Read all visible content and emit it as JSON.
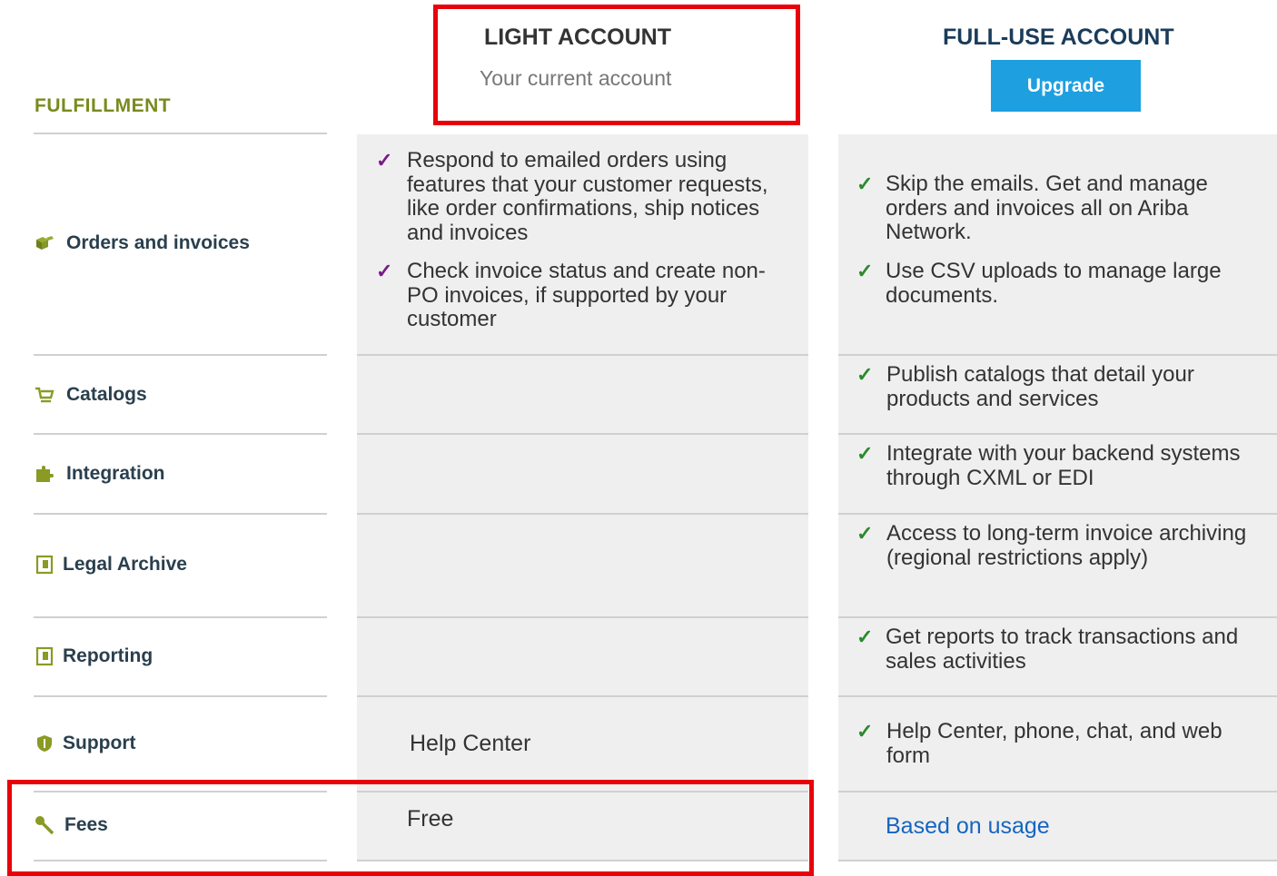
{
  "header": {
    "light_title": "LIGHT ACCOUNT",
    "light_subtitle": "Your current account",
    "full_title": "FULL-USE ACCOUNT",
    "upgrade_label": "Upgrade",
    "section_label": "FULFILLMENT"
  },
  "rows": [
    {
      "label": "Orders and invoices",
      "icon": "boxes-icon"
    },
    {
      "label": "Catalogs",
      "icon": "cart-icon"
    },
    {
      "label": "Integration",
      "icon": "puzzle-icon"
    },
    {
      "label": "Legal Archive",
      "icon": "document-icon"
    },
    {
      "label": "Reporting",
      "icon": "document-icon"
    },
    {
      "label": "Support",
      "icon": "shield-icon"
    },
    {
      "label": "Fees",
      "icon": "key-icon"
    }
  ],
  "light": {
    "orders_1": "Respond to emailed orders using features that your customer requests, like order confirmations, ship notices and invoices",
    "orders_2": "Check invoice status and create non-PO invoices, if supported by your customer",
    "support": "Help Center",
    "fees": "Free"
  },
  "full": {
    "orders_1": "Skip the emails. Get and manage orders and invoices all on Ariba Network.",
    "orders_2": "Use CSV uploads to manage large documents.",
    "catalogs": "Publish catalogs that detail your products and services",
    "integration": "Integrate with your backend systems through CXML or EDI",
    "archive": "Access to long-term invoice archiving (regional restrictions apply)",
    "reporting": "Get reports to track transactions and sales activities",
    "support": "Help Center, phone, chat, and web form",
    "fees": "Based on usage"
  },
  "check_glyph": "✓",
  "colors": {
    "accent_blue": "#1e9fe0",
    "highlight_red": "#e8000b",
    "section_green": "#7a8a1e",
    "check_purple": "#7a1a8a",
    "check_green": "#2a8a2a",
    "link_blue": "#1565c0"
  }
}
